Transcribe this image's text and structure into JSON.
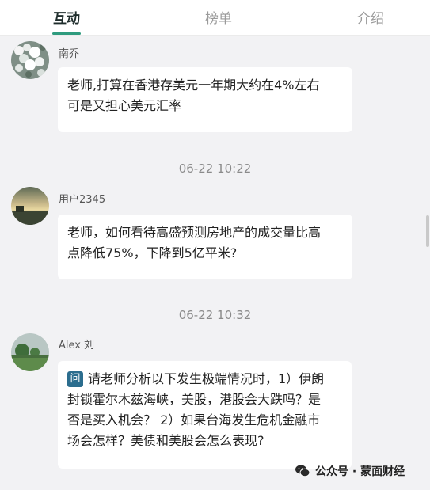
{
  "tabs": [
    {
      "label": "互动"
    },
    {
      "label": "榜单"
    },
    {
      "label": "介绍"
    }
  ],
  "messages": [
    {
      "user": "南乔",
      "lines": [
        "老师,打算在香港存美元一年期大约在4%左右",
        "可是又担心美元汇率"
      ]
    },
    {
      "timestamp": "06-22 10:22",
      "user": "用户2345",
      "lines": [
        "老师，如何看待高盛预测房地产的成交量比高",
        "点降低75%，下降到5亿平米?"
      ]
    },
    {
      "timestamp": "06-22 10:32",
      "user": "Alex 刘",
      "badge": "问",
      "lines": [
        "请老师分析以下发生极端情况时，1）伊朗",
        "封锁霍尔木兹海峡，美股，港股会大跌吗？是",
        "否是买入机会？ 2）如果台海发生危机金融市",
        "场会怎样？美债和美股会怎么表现?"
      ]
    }
  ],
  "watermark": {
    "text": "公众号 · 蒙面财经"
  },
  "colors": {
    "accent": "#2f9b7e",
    "background": "#f2f2f4",
    "question_badge": "#2b6d8e"
  }
}
